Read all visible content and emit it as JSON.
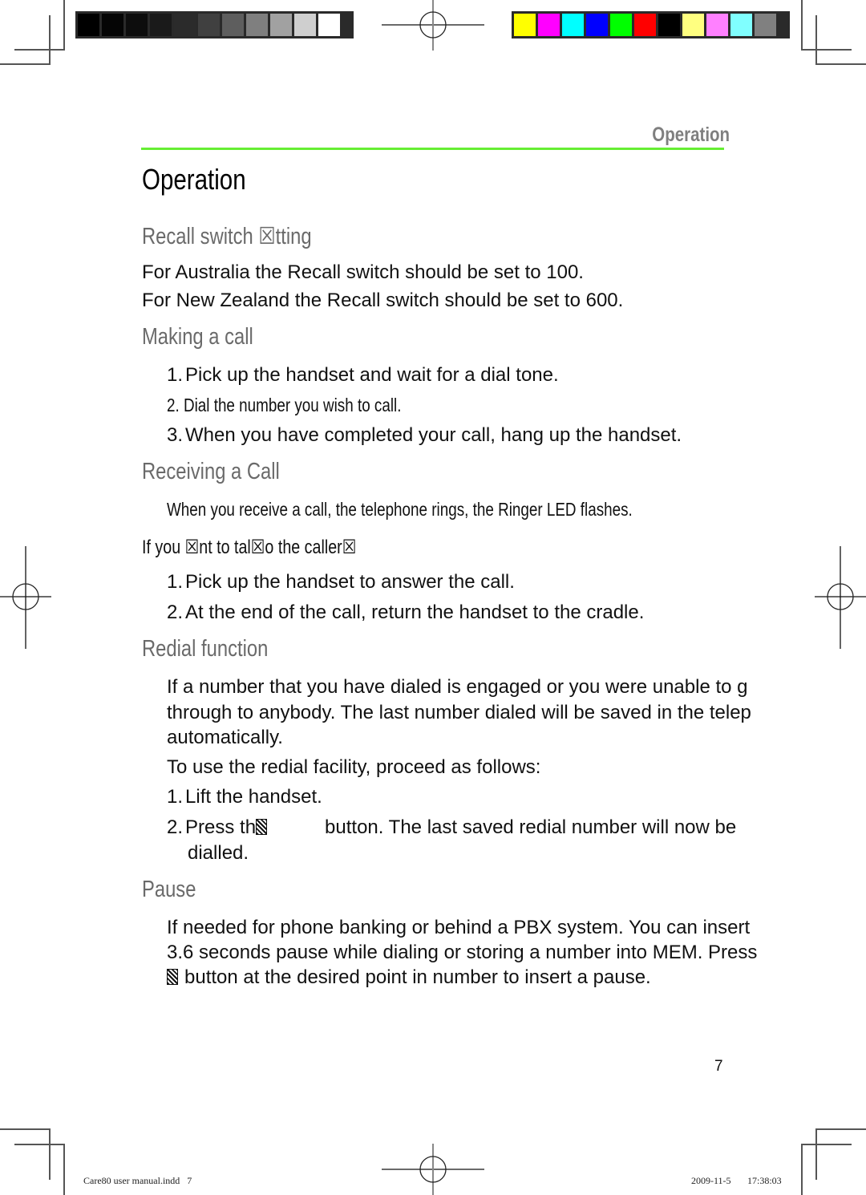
{
  "print_marks": {
    "gray_swatches": [
      "#000000",
      "#050505",
      "#0d0d0d",
      "#1a1a1a",
      "#2b2b2b",
      "#404040",
      "#5e5e5e",
      "#7f7f7f",
      "#a1a1a1",
      "#cfcfcf",
      "#ffffff"
    ],
    "color_swatches": [
      "#ffff00",
      "#ff00ff",
      "#00ffff",
      "#0000ff",
      "#00ff00",
      "#ff0000",
      "#000000",
      "#ffff80",
      "#ff80ff",
      "#80ffff",
      "#808080"
    ]
  },
  "header": {
    "running_head": "Operation",
    "rule_color": "#66ee33"
  },
  "page_title": "Operation",
  "sections": {
    "recall": {
      "heading": "Recall switch ☒tting",
      "lines": [
        "For Australia the Recall switch should be set to 100.",
        "For New Zealand the Recall switch should be set to 600."
      ]
    },
    "making_call": {
      "heading": "Making a call",
      "steps": [
        {
          "num": "1.",
          "text": "Pick up the handset and wait for a dial tone."
        },
        {
          "num": "2.",
          "text": "Dial the number you wish to call."
        },
        {
          "num": "3.",
          "text": "When you have completed your call, hang up the handset."
        }
      ]
    },
    "receiving_call": {
      "heading": "Receiving a Call",
      "intro": "When you receive a call, the telephone rings, the Ringer LED flashes.",
      "lead": "If you ☒nt to tal☒o the caller☒",
      "steps": [
        {
          "num": "1.",
          "text": "Pick up the handset to answer the call."
        },
        {
          "num": "2.",
          "text": "At the end of the call, return the handset to the cradle."
        }
      ]
    },
    "redial": {
      "heading": "Redial function",
      "para_lines": [
        "If a number that you have dialed is engaged or you were unable to g",
        "through to anybody. The last number dialed will be saved in the telep",
        "automatically."
      ],
      "proceed": "To use the redial facility, proceed as follows:",
      "step1_num": "1.",
      "step1_text": "Lift the handset.",
      "step2_num": "2.",
      "step2_pre": "Press th",
      "step2_post": "button. The last saved redial number will now be",
      "step2_cont": "dialled."
    },
    "pause": {
      "heading": "Pause",
      "line1": "If needed for phone banking or behind a PBX system. You can insert",
      "line2": "3.6 seconds pause while dialing or storing a number into MEM. Press",
      "line3": "button at the desired point in number to insert a pause."
    }
  },
  "page_number": "7",
  "slug": {
    "file": "Care80 user manual.indd   7",
    "date": "2009-11-5",
    "time": "17:38:03"
  }
}
